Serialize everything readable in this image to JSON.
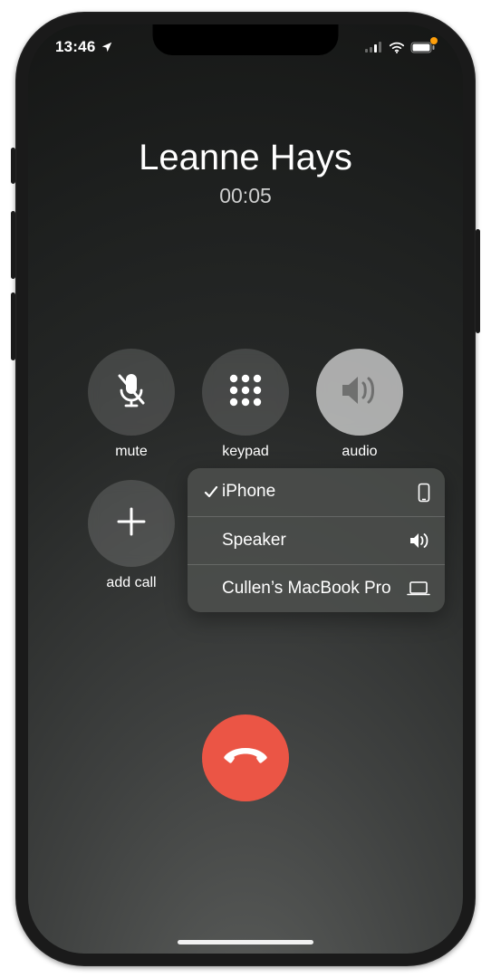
{
  "statusbar": {
    "time": "13:46",
    "location_arrow": true,
    "mic_indicator": true
  },
  "caller": {
    "name": "Leanne Hays",
    "duration": "00:05"
  },
  "controls": {
    "mute": {
      "label": "mute"
    },
    "keypad": {
      "label": "keypad"
    },
    "audio": {
      "label": "audio",
      "active": true
    },
    "addcall": {
      "label": "add call"
    }
  },
  "audio_menu": [
    {
      "label": "iPhone",
      "selected": true,
      "icon": "phone"
    },
    {
      "label": "Speaker",
      "selected": false,
      "icon": "speaker"
    },
    {
      "label": "Cullen’s MacBook Pro",
      "selected": false,
      "icon": "laptop"
    }
  ],
  "end_call_label": "end call"
}
